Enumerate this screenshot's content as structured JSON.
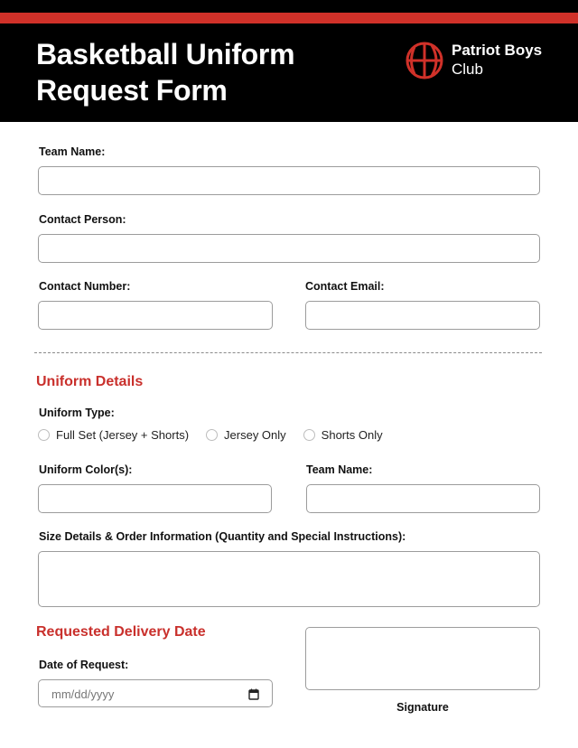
{
  "header": {
    "title_line1": "Basketball Uniform",
    "title_line2": "Request Form",
    "club_line1": "Patriot Boys",
    "club_line2": "Club",
    "logo_icon": "basketball-icon",
    "accent_color": "#d03129"
  },
  "contact": {
    "team_name_label": "Team Name:",
    "team_name_value": "",
    "contact_person_label": "Contact Person:",
    "contact_person_value": "",
    "contact_number_label": "Contact Number:",
    "contact_number_value": "",
    "contact_email_label": "Contact Email:",
    "contact_email_value": ""
  },
  "uniform": {
    "section_title": "Uniform Details",
    "type_label": "Uniform Type:",
    "type_options": [
      {
        "label": "Full Set (Jersey + Shorts)",
        "checked": false
      },
      {
        "label": "Jersey Only",
        "checked": false
      },
      {
        "label": "Shorts Only",
        "checked": false
      }
    ],
    "color_label": "Uniform Color(s):",
    "color_value": "",
    "team_name_label": "Team Name:",
    "team_name_value": "",
    "size_label": "Size Details & Order Information (Quantity and Special Instructions):",
    "size_value": ""
  },
  "delivery": {
    "section_title": "Requested Delivery Date",
    "date_label": "Date of Request:",
    "date_placeholder": "mm/dd/yyyy",
    "calendar_icon": "calendar-icon",
    "signature_label": "Signature"
  }
}
